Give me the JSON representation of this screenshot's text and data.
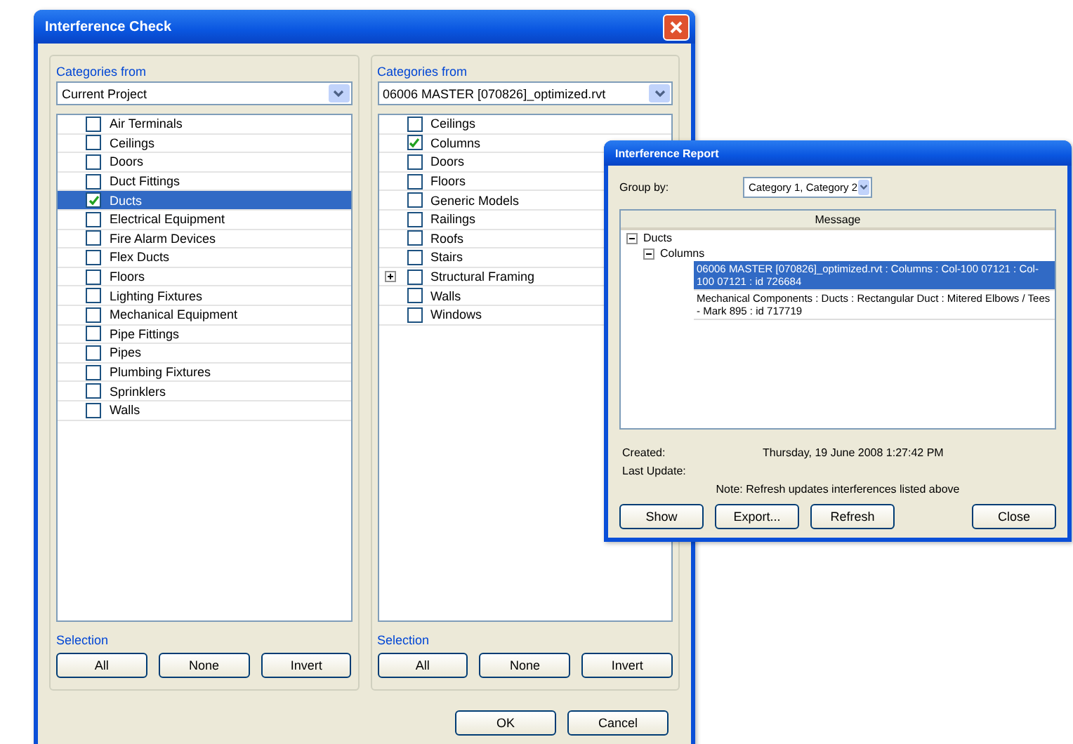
{
  "dialog": {
    "title": "Interference Check",
    "panels": [
      {
        "group_label": "Categories from",
        "source": "Current Project",
        "items": [
          {
            "label": "Air Terminals",
            "checked": false,
            "selected": false,
            "expandable": false
          },
          {
            "label": "Ceilings",
            "checked": false,
            "selected": false,
            "expandable": false
          },
          {
            "label": "Doors",
            "checked": false,
            "selected": false,
            "expandable": false
          },
          {
            "label": "Duct Fittings",
            "checked": false,
            "selected": false,
            "expandable": false
          },
          {
            "label": "Ducts",
            "checked": true,
            "selected": true,
            "expandable": false
          },
          {
            "label": "Electrical Equipment",
            "checked": false,
            "selected": false,
            "expandable": false
          },
          {
            "label": "Fire Alarm Devices",
            "checked": false,
            "selected": false,
            "expandable": false
          },
          {
            "label": "Flex Ducts",
            "checked": false,
            "selected": false,
            "expandable": false
          },
          {
            "label": "Floors",
            "checked": false,
            "selected": false,
            "expandable": false
          },
          {
            "label": "Lighting Fixtures",
            "checked": false,
            "selected": false,
            "expandable": false
          },
          {
            "label": "Mechanical Equipment",
            "checked": false,
            "selected": false,
            "expandable": false
          },
          {
            "label": "Pipe Fittings",
            "checked": false,
            "selected": false,
            "expandable": false
          },
          {
            "label": "Pipes",
            "checked": false,
            "selected": false,
            "expandable": false
          },
          {
            "label": "Plumbing Fixtures",
            "checked": false,
            "selected": false,
            "expandable": false
          },
          {
            "label": "Sprinklers",
            "checked": false,
            "selected": false,
            "expandable": false
          },
          {
            "label": "Walls",
            "checked": false,
            "selected": false,
            "expandable": false
          }
        ],
        "selection_label": "Selection",
        "buttons": [
          "All",
          "None",
          "Invert"
        ]
      },
      {
        "group_label": "Categories from",
        "source": "06006 MASTER [070826]_optimized.rvt",
        "items": [
          {
            "label": "Ceilings",
            "checked": false,
            "selected": false,
            "expandable": false
          },
          {
            "label": "Columns",
            "checked": true,
            "selected": false,
            "expandable": false
          },
          {
            "label": "Doors",
            "checked": false,
            "selected": false,
            "expandable": false
          },
          {
            "label": "Floors",
            "checked": false,
            "selected": false,
            "expandable": false
          },
          {
            "label": "Generic Models",
            "checked": false,
            "selected": false,
            "expandable": false
          },
          {
            "label": "Railings",
            "checked": false,
            "selected": false,
            "expandable": false
          },
          {
            "label": "Roofs",
            "checked": false,
            "selected": false,
            "expandable": false
          },
          {
            "label": "Stairs",
            "checked": false,
            "selected": false,
            "expandable": false
          },
          {
            "label": "Structural Framing",
            "checked": false,
            "selected": false,
            "expandable": true
          },
          {
            "label": "Walls",
            "checked": false,
            "selected": false,
            "expandable": false
          },
          {
            "label": "Windows",
            "checked": false,
            "selected": false,
            "expandable": false
          }
        ],
        "selection_label": "Selection",
        "buttons": [
          "All",
          "None",
          "Invert"
        ]
      }
    ],
    "buttons": [
      "OK",
      "Cancel"
    ]
  },
  "report": {
    "title": "Interference Report",
    "group_by_label": "Group by:",
    "group_by_value": "Category 1, Category 2",
    "column": "Message",
    "tree": [
      {
        "label": "Ducts",
        "expanded": true,
        "children": [
          {
            "label": "Columns",
            "expanded": true,
            "children": [
              {
                "label": "06006 MASTER [070826]_optimized.rvt : Columns : Col-100 07121 : Col-100 07121 : id 726684",
                "selected": true
              },
              {
                "label": "Mechanical Components : Ducts : Rectangular Duct : Mitered Elbows / Tees - Mark 895 : id 717719",
                "selected": false
              }
            ]
          }
        ]
      }
    ],
    "created_label": "Created:",
    "created_value": "Thursday, 19 June 2008 1:27:42 PM",
    "last_update_label": "Last Update:",
    "note": "Note: Refresh updates interferences listed above",
    "buttons": [
      "Show",
      "Export...",
      "Refresh",
      "Close"
    ]
  }
}
